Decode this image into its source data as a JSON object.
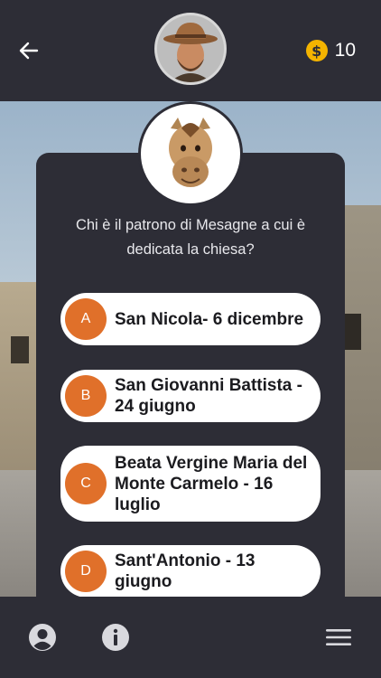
{
  "header": {
    "back_icon": "arrow-left-icon",
    "avatar_icon": "cowboy-avatar",
    "coin_icon": "dollar-coin-icon",
    "coin_symbol": "$",
    "coin_count": "10"
  },
  "quiz": {
    "mascot_icon": "horse-head-icon",
    "question": "Chi è il patrono di Mesagne a cui è dedicata la chiesa?",
    "answers": [
      {
        "letter": "A",
        "text": "San Nicola- 6 dicembre"
      },
      {
        "letter": "B",
        "text": "San Giovanni Battista - 24 giugno"
      },
      {
        "letter": "C",
        "text": "Beata Vergine Maria del Monte Carmelo - 16 luglio"
      },
      {
        "letter": "D",
        "text": "Sant'Antonio - 13 giugno"
      }
    ]
  },
  "bottom_nav": {
    "items": [
      "user-profile-icon",
      "info-icon",
      "menu-hamburger-icon"
    ]
  },
  "colors": {
    "bar_background": "#2d2d36",
    "accent_orange": "#e0702a",
    "coin_gold": "#f4b400"
  }
}
